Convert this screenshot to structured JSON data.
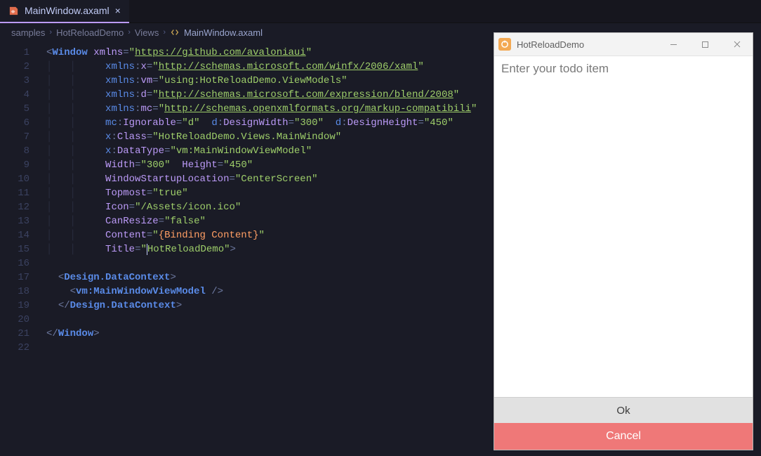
{
  "tab": {
    "filename": "MainWindow.axaml",
    "close_glyph": "×"
  },
  "breadcrumbs": {
    "items": [
      "samples",
      "HotReloadDemo",
      "Views",
      "MainWindow.axaml"
    ]
  },
  "editor": {
    "tokens": {
      "window": "Window",
      "xmlns": "xmlns",
      "xmlns_url": "https://github.com/avaloniaui",
      "xmlns_x": "xmlns:x",
      "xmlns_x_url": "http://schemas.microsoft.com/winfx/2006/xaml",
      "xmlns_vm": "xmlns:vm",
      "xmlns_vm_val": "using:HotReloadDemo.ViewModels",
      "xmlns_d": "xmlns:d",
      "xmlns_d_url": "http://schemas.microsoft.com/expression/blend/2008",
      "xmlns_mc": "xmlns:mc",
      "xmlns_mc_url": "http://schemas.openxmlformats.org/markup-compatibili",
      "mc_ignorable": "mc:Ignorable",
      "d_val": "d",
      "d_designwidth": "d:DesignWidth",
      "dw_val": "300",
      "d_designheight": "d:DesignHeight",
      "dh_val": "450",
      "x_class": "x:Class",
      "x_class_val": "HotReloadDemo.Views.MainWindow",
      "x_datatype": "x:DataType",
      "x_datatype_val": "vm:MainWindowViewModel",
      "width": "Width",
      "width_val": "300",
      "height": "Height",
      "height_val": "450",
      "wsl": "WindowStartupLocation",
      "wsl_val": "CenterScreen",
      "topmost": "Topmost",
      "topmost_val": "true",
      "icon": "Icon",
      "icon_val": "/Assets/icon.ico",
      "canresize": "CanResize",
      "canresize_val": "false",
      "content": "Content",
      "content_val": "{Binding Content}",
      "title": "Title",
      "title_val": "HotReloadDemo",
      "design_dc": "Design.DataContext",
      "vm_mwvm": "vm:MainWindowViewModel"
    },
    "lines": 22
  },
  "preview": {
    "title": "HotReloadDemo",
    "placeholder": "Enter your todo item",
    "ok": "Ok",
    "cancel": "Cancel"
  },
  "colors": {
    "accent_purple": "#bb9af7",
    "string_green": "#9ece6a",
    "binding_orange": "#ff9e64",
    "tag_blue": "#5a8be8",
    "danger": "#ef7878"
  }
}
